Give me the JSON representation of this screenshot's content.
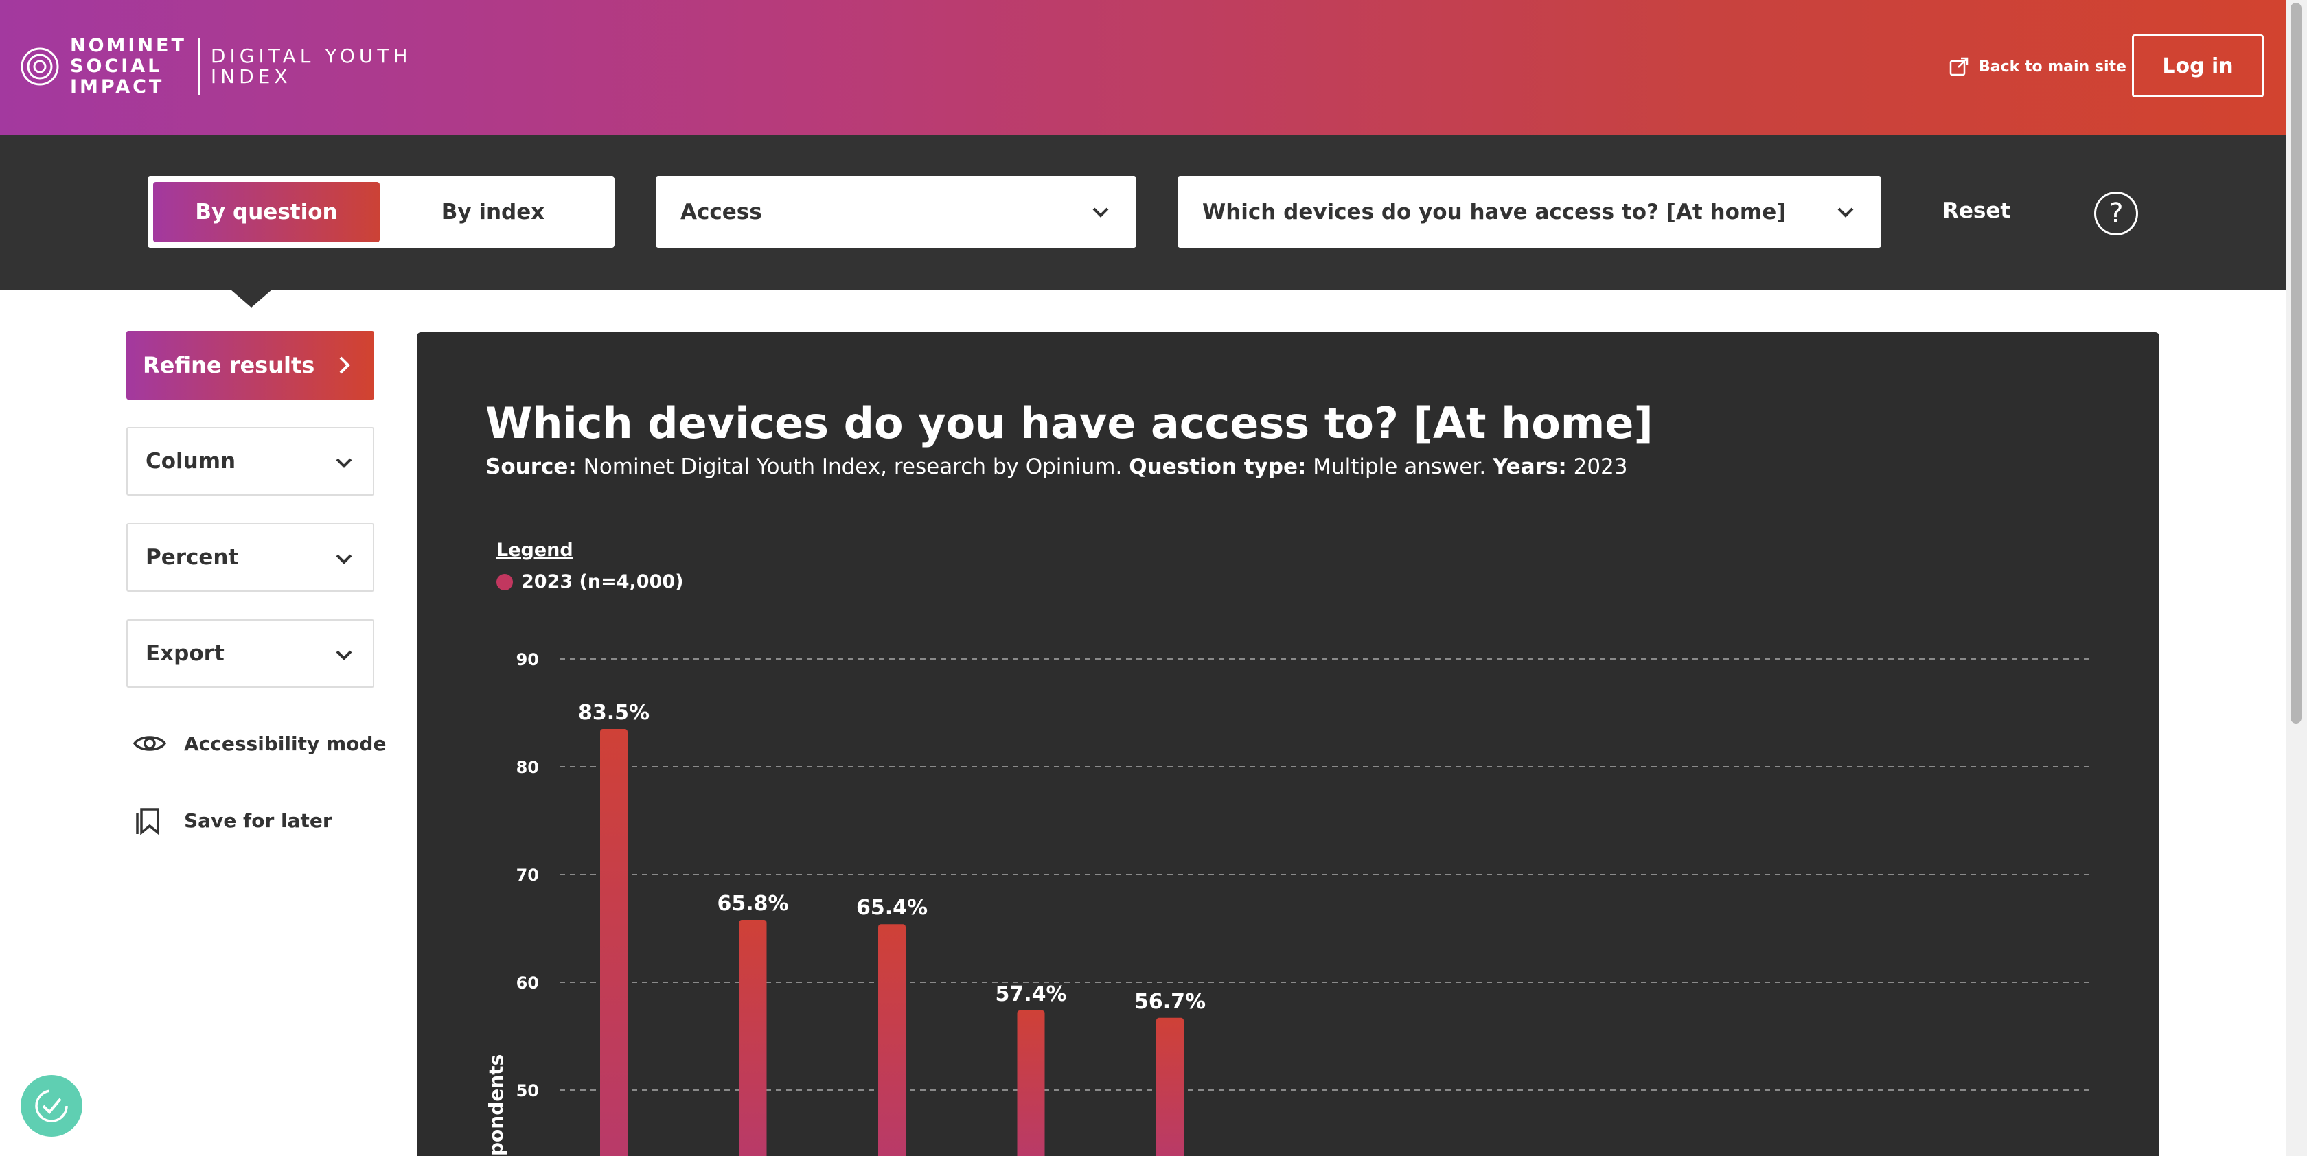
{
  "header": {
    "logo_lines": [
      "NOMINET",
      "SOCIAL",
      "IMPACT"
    ],
    "product_lines": [
      "DIGITAL YOUTH",
      "INDEX"
    ],
    "back_link": "Back to main site",
    "login": "Log in"
  },
  "toolbar": {
    "mode_options": [
      "By question",
      "By index"
    ],
    "mode_selected": "By question",
    "category_select": "Access",
    "question_select": "Which devices do you have access to? [At home]",
    "reset": "Reset",
    "help": "?"
  },
  "sidebar": {
    "refine": "Refine results",
    "selects": [
      "Column",
      "Percent",
      "Export"
    ],
    "links": [
      "Accessibility mode",
      "Save for later"
    ]
  },
  "chart": {
    "title": "Which devices do you have access to? [At home]",
    "source_label": "Source:",
    "source_value": "Nominet Digital Youth Index, research by Opinium.",
    "qtype_label": "Question type:",
    "qtype_value": "Multiple answer.",
    "years_label": "Years:",
    "years_value": "2023",
    "legend_title": "Legend",
    "legend_item": "2023 (n=4,000)",
    "ylabel_visible": "pondents"
  },
  "colors": {
    "accent_purple": "#a3399f",
    "accent_red": "#d2432f",
    "legend_dot": "#c2375f",
    "bar_top": "#cf4137",
    "bar_bottom": "#b83a6a"
  },
  "chart_data": {
    "type": "bar",
    "values": [
      83.5,
      65.8,
      65.4,
      57.4,
      56.7
    ],
    "data_labels": [
      "83.5%",
      "65.8%",
      "65.4%",
      "57.4%",
      "56.7%"
    ],
    "y_ticks": [
      50,
      60,
      70,
      80,
      90
    ],
    "ylim": [
      46,
      90
    ],
    "grid": true,
    "legend_position": "top-left",
    "series": [
      {
        "name": "2023 (n=4,000)",
        "values": [
          83.5,
          65.8,
          65.4,
          57.4,
          56.7
        ]
      }
    ]
  }
}
